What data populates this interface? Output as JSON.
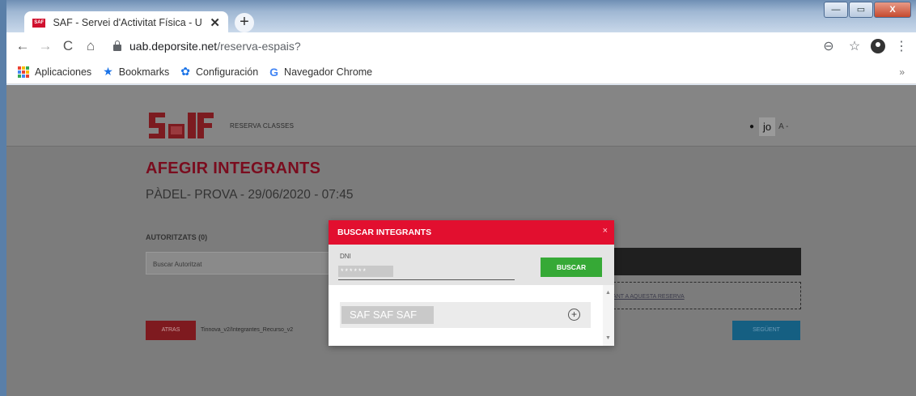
{
  "browser": {
    "tab_title": "SAF - Servei d'Activitat Física - U",
    "tab_close": "✕",
    "new_tab": "+",
    "favicon_text": "SAF",
    "url_domain": "uab.deporsite.net",
    "url_path": "/reserva-espais?",
    "window_buttons": {
      "minimize": "—",
      "maximize": "▭",
      "close": "X"
    },
    "nav_icons": {
      "back": "←",
      "forward": "→",
      "reload": "C",
      "home": "⌂"
    },
    "toolbar_icons": {
      "zoom": "⊖",
      "star": "☆",
      "menu": "⋮"
    },
    "bookmarks": [
      {
        "label": "Aplicaciones",
        "icon": "apps-grid-icon"
      },
      {
        "label": "Bookmarks",
        "icon": "star-icon",
        "glyph": "★",
        "color": "#1a73e8"
      },
      {
        "label": "Configuración",
        "icon": "gear-icon",
        "glyph": "✿",
        "color": "#1a73e8"
      },
      {
        "label": "Navegador Chrome",
        "icon": "google-g-icon",
        "glyph": "G",
        "color": "#4285f4"
      }
    ],
    "bookmarks_more": "»"
  },
  "site": {
    "nav_label": "RESERVA CLASSES",
    "user_name": "jo",
    "user_suffix": "A -",
    "page_title": "AFEGIR INTEGRANTS",
    "page_subtitle": "PÀDEL- PROVA - 29/06/2020 - 07:45",
    "section_label": "AUTORITZATS (0)",
    "search_placeholder": "Buscar Autoritzat",
    "dropzone_text": "RANT A AQUESTA RESERVA",
    "back_button": "ATRAS",
    "path_text": "Tinnova_v2/Integrantes_Recurso_v2",
    "next_button": "SEGÜENT"
  },
  "modal": {
    "title": "BUSCAR INTEGRANTS",
    "close": "×",
    "dni_label": "DNI",
    "dni_value": "******",
    "search_button": "BUSCAR",
    "results": [
      {
        "name": "SAF SAF SAF",
        "add": "+"
      }
    ],
    "scroll_up": "▲",
    "scroll_down": "▼"
  },
  "colors": {
    "modal_header": "#e20f2f",
    "search_button": "#36a936",
    "page_title": "#7a0c1e",
    "back_button": "#7e1a1f",
    "next_button": "#155f82"
  }
}
